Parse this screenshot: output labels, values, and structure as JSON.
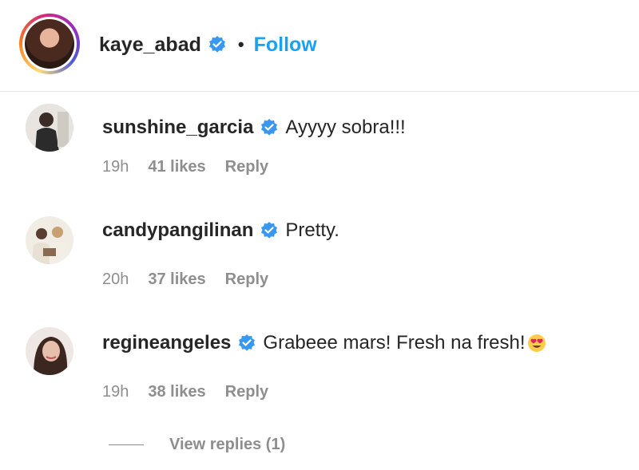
{
  "post_header": {
    "username": "kaye_abad",
    "separator": "•",
    "follow_label": "Follow"
  },
  "comments": [
    {
      "username": "sunshine_garcia",
      "text": "Ayyyy sobra!!!",
      "time": "19h",
      "likes": "41 likes",
      "reply_label": "Reply"
    },
    {
      "username": "candypangilinan",
      "text": "Pretty.",
      "time": "20h",
      "likes": "37 likes",
      "reply_label": "Reply"
    },
    {
      "username": "regineangeles",
      "text": "Grabeee mars! Fresh na fresh!",
      "emoji": "heart-eyes-emoji",
      "time": "19h",
      "likes": "38 likes",
      "reply_label": "Reply"
    }
  ],
  "view_replies_label": "View replies (1)",
  "colors": {
    "verified_blue": "#3897f0",
    "follow_blue": "#1aa1f0",
    "secondary_text": "#8e8e8e",
    "primary_text": "#262626"
  }
}
